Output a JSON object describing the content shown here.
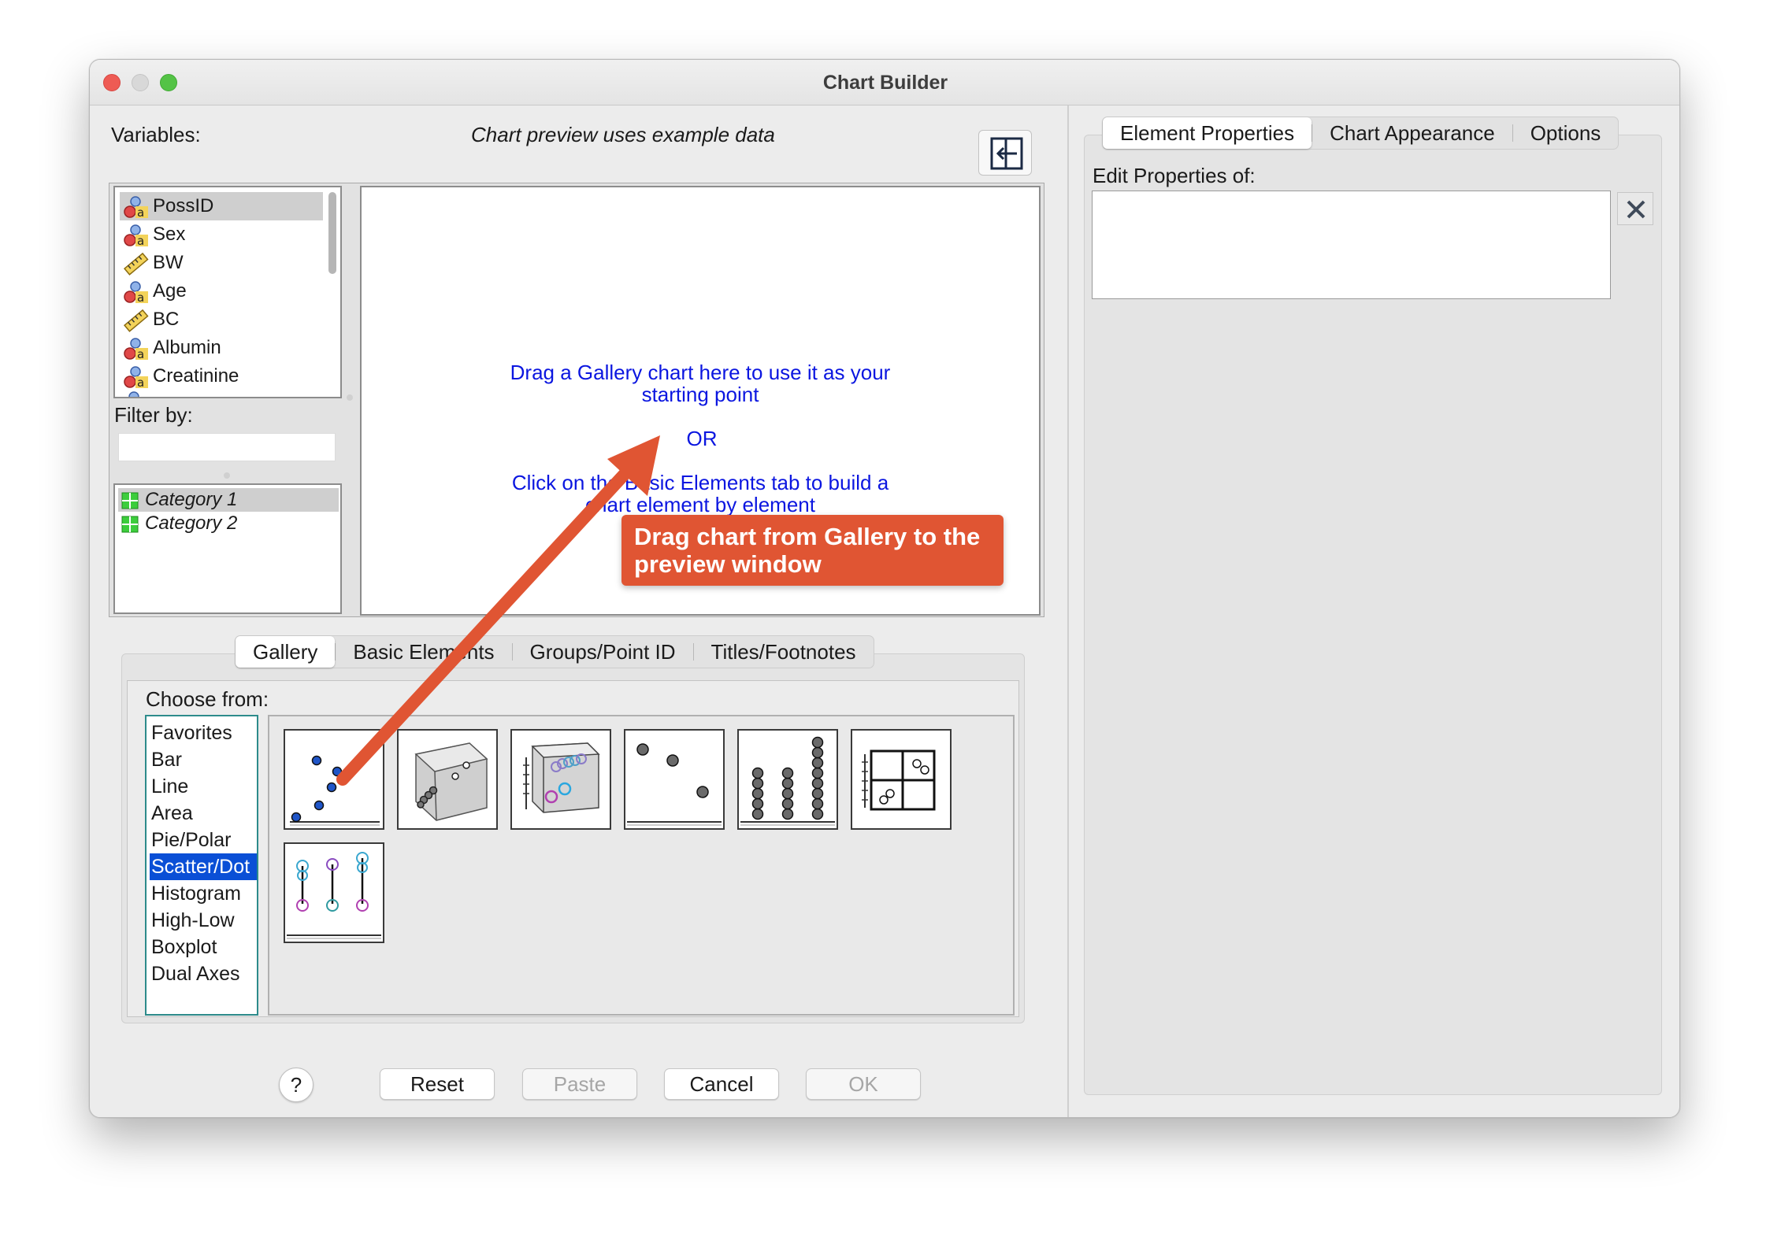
{
  "window": {
    "title": "Chart Builder"
  },
  "left": {
    "variables_label": "Variables:",
    "preview_note": "Chart preview uses example data",
    "variables": [
      {
        "name": "PossID",
        "icon": "nominal-icon",
        "selected": true
      },
      {
        "name": "Sex",
        "icon": "nominal-icon"
      },
      {
        "name": "BW",
        "icon": "scale-icon"
      },
      {
        "name": "Age",
        "icon": "nominal-icon"
      },
      {
        "name": "BC",
        "icon": "scale-icon"
      },
      {
        "name": "Albumin",
        "icon": "nominal-icon"
      },
      {
        "name": "Creatinine",
        "icon": "nominal-icon"
      }
    ],
    "filter_label": "Filter by:",
    "filter_value": "",
    "categories": [
      "Category 1",
      "Category 2"
    ]
  },
  "canvas": {
    "line1": "Drag a Gallery chart here to use it as your",
    "line2": "starting point",
    "or": "OR",
    "line3": "Click on the Basic Elements tab to build a",
    "line4": "chart element by element"
  },
  "callout": {
    "line1": "Drag chart from Gallery to the",
    "line2": "preview window"
  },
  "gallery": {
    "tabs": [
      "Gallery",
      "Basic Elements",
      "Groups/Point ID",
      "Titles/Footnotes"
    ],
    "choose_from": "Choose from:",
    "types": [
      "Favorites",
      "Bar",
      "Line",
      "Area",
      "Pie/Polar",
      "Scatter/Dot",
      "Histogram",
      "High-Low",
      "Boxplot",
      "Dual Axes"
    ],
    "selected_type": "Scatter/Dot"
  },
  "buttons": {
    "help": "?",
    "reset": "Reset",
    "paste": "Paste",
    "cancel": "Cancel",
    "ok": "OK"
  },
  "right": {
    "tabs": [
      "Element Properties",
      "Chart Appearance",
      "Options"
    ],
    "edit_label": "Edit Properties of:"
  },
  "colors": {
    "accent_selection": "#0a4fd6",
    "canvas_text": "#0b16e0",
    "callout": "#e05533"
  }
}
